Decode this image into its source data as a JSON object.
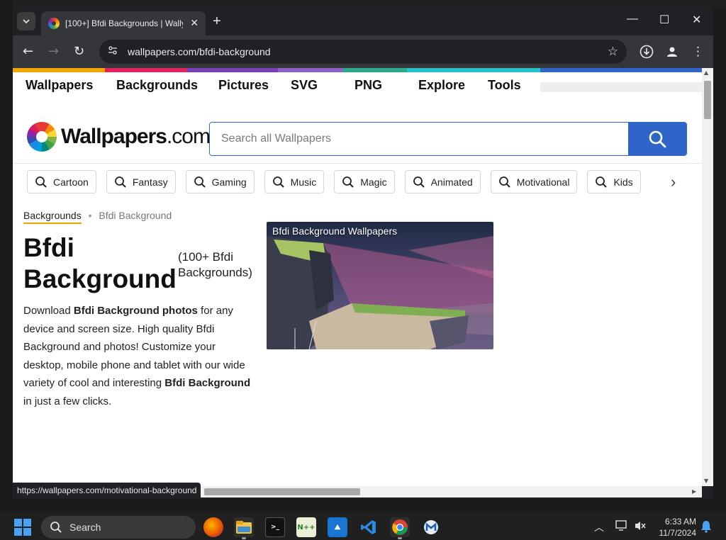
{
  "browser": {
    "tab_title": "[100+] Bfdi Backgrounds | Wally",
    "url": "wallpapers.com/bfdi-background",
    "status_url": "https://wallpapers.com/motivational-background"
  },
  "site": {
    "topnav": [
      "Wallpapers",
      "Backgrounds",
      "Pictures",
      "SVG",
      "PNG",
      "Explore",
      "Tools"
    ],
    "logo_text": "Wallpapers",
    "logo_suffix": ".com",
    "search_placeholder": "Search all Wallpapers",
    "chips": [
      "Cartoon",
      "Fantasy",
      "Gaming",
      "Music",
      "Magic",
      "Animated",
      "Motivational",
      "Kids"
    ],
    "breadcrumb": {
      "parent": "Backgrounds",
      "separator": "•",
      "current": "Bfdi Background"
    },
    "title": "Bfdi Background",
    "count_label": "(100+ Bfdi Backgrounds)",
    "description": {
      "p1": "Download ",
      "b1": "Bfdi Background photos",
      "p2": " for any device and screen size. High quality Bfdi Background and photos! Customize your desktop, mobile phone and tablet with our wide variety of cool and interesting ",
      "b2": "Bfdi Background",
      "p3": " in just a few clicks."
    },
    "thumbnail_label": "Bfdi Background Wallpapers",
    "colors": {
      "accent_blue": "#2f65c8",
      "underline": "#f0a500"
    }
  },
  "taskbar": {
    "search_label": "Search",
    "time": "6:33 AM",
    "date": "11/7/2024"
  }
}
